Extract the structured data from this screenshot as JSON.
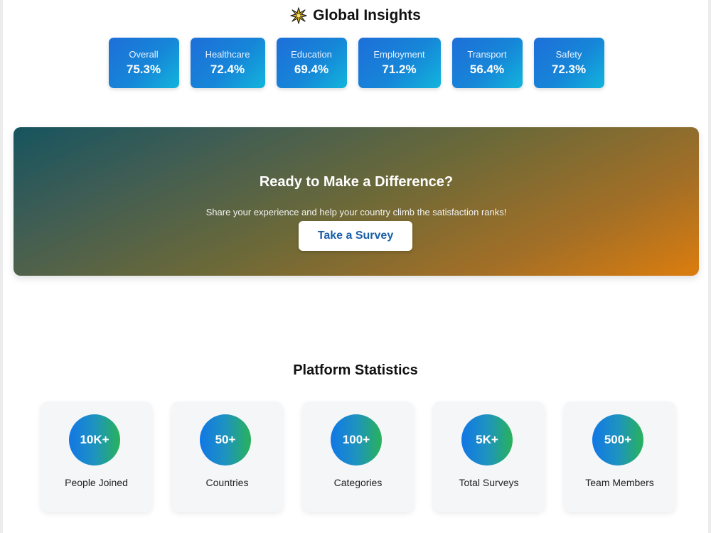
{
  "insights": {
    "title": "Global Insights",
    "icon": "sparkle-icon",
    "cards": [
      {
        "label": "Overall",
        "value": "75.3%"
      },
      {
        "label": "Healthcare",
        "value": "72.4%"
      },
      {
        "label": "Education",
        "value": "69.4%"
      },
      {
        "label": "Employment",
        "value": "71.2%"
      },
      {
        "label": "Transport",
        "value": "56.4%"
      },
      {
        "label": "Safety",
        "value": "72.3%"
      }
    ]
  },
  "cta": {
    "title": "Ready to Make a Difference?",
    "subtitle": "Share your experience and help your country climb the satisfaction ranks!",
    "button_label": "Take a Survey"
  },
  "stats": {
    "title": "Platform Statistics",
    "items": [
      {
        "value": "10K+",
        "label": "People Joined"
      },
      {
        "value": "50+",
        "label": "Countries"
      },
      {
        "value": "100+",
        "label": "Categories"
      },
      {
        "value": "5K+",
        "label": "Total Surveys"
      },
      {
        "value": "500+",
        "label": "Team Members"
      }
    ]
  },
  "colors": {
    "card_gradient_start": "#1e6fd9",
    "card_gradient_end": "#12b5dc",
    "banner_gradient_start": "#16545f",
    "banner_gradient_end": "#dc7d0e",
    "button_text": "#1b5fa8",
    "stat_circle_start": "#1177e6",
    "stat_circle_end": "#29b25a"
  }
}
